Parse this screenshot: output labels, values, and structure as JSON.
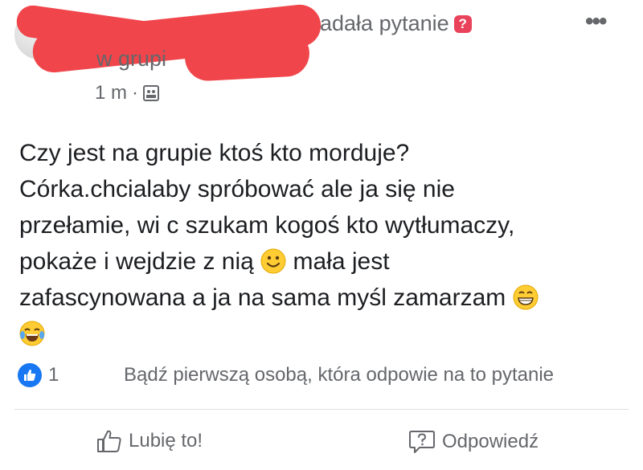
{
  "header": {
    "asked_text": "adała pytanie",
    "question_badge": "?",
    "in_group": "w grupi",
    "time": "1 m",
    "more_icon": "more-dots-icon"
  },
  "post": {
    "line1": "Czy jest na grupie ktoś kto morduje?",
    "line2": "Córka.chcialaby spróbować ale ja się nie",
    "line3": "przełamie, wi c szukam kogoś kto wytłumaczy,",
    "line4a": "pokaże i wejdzie z nią",
    "line4b": "mała jest",
    "line5": "zafascynowana a ja na sama myśl zamarzam"
  },
  "reactions": {
    "like_count": "1",
    "first_answer_prompt": "Bądź pierwszą osobą, która odpowie na to pytanie"
  },
  "actions": {
    "like_label": "Lubię to!",
    "answer_label": "Odpowiedź"
  },
  "colors": {
    "accent": "#1877f2",
    "muted": "#65676b",
    "badge": "#e8435a",
    "redaction": "#f0454a"
  }
}
